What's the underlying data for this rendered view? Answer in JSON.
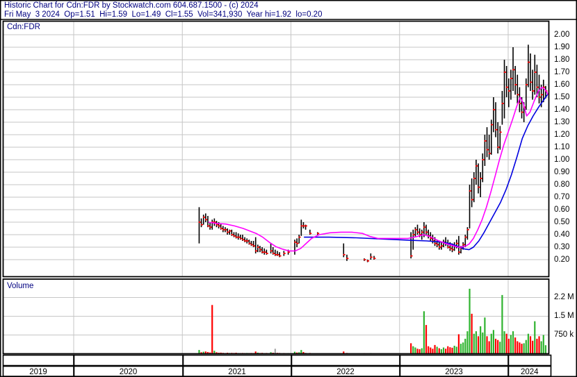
{
  "header": {
    "line1": "Historic Chart for Cdn:FDR by Stockwatch.com 604.687.1500 - (c) 2024",
    "line2": "Fri May  3 2024  Op=1.51  Hi=1.59  Lo=1.49  Cl=1.55  Vol=341,930  Year hi=1.92  lo=0.20"
  },
  "price_panel_label": "Cdn:FDR",
  "volume_panel_label": "Volume",
  "colors": {
    "text_navy": "#000080",
    "text_black": "#000000",
    "grid": "#c6c6c6",
    "bar_black": "#000000",
    "close_red": "#ff0000",
    "ma_fast": "#ff00ff",
    "ma_slow": "#0000e0",
    "vol_up": "#2fb32f",
    "vol_down": "#ff0000",
    "vol_flat": "#a8a8a8",
    "border": "#000000"
  },
  "chart_data": {
    "type": "ohlc-bars+volume",
    "title": "Historic Chart for Cdn:FDR",
    "symbol": "Cdn:FDR",
    "x_unit": "fractional_year",
    "x_range": [
      2019.35,
      2024.38
    ],
    "year_ticks": [
      2020,
      2021,
      2022,
      2023,
      2024
    ],
    "price_axis": [
      {
        "label": "2.00",
        "value": 2.0
      },
      {
        "label": "1.90",
        "value": 1.9
      },
      {
        "label": "1.80",
        "value": 1.8
      },
      {
        "label": "1.70",
        "value": 1.7
      },
      {
        "label": "1.60",
        "value": 1.6
      },
      {
        "label": "1.50",
        "value": 1.5
      },
      {
        "label": "1.40",
        "value": 1.4
      },
      {
        "label": "1.30",
        "value": 1.3
      },
      {
        "label": "1.20",
        "value": 1.2
      },
      {
        "label": "1.10",
        "value": 1.1
      },
      {
        "label": "1.00",
        "value": 1.0
      },
      {
        "label": "0.90",
        "value": 0.9
      },
      {
        "label": "0.80",
        "value": 0.8
      },
      {
        "label": "0.70",
        "value": 0.7
      },
      {
        "label": "0.60",
        "value": 0.6
      },
      {
        "label": "0.50",
        "value": 0.5
      },
      {
        "label": "0.40",
        "value": 0.4
      },
      {
        "label": "0.30",
        "value": 0.3
      },
      {
        "label": "0.20",
        "value": 0.2
      }
    ],
    "volume_axis": [
      {
        "label": "2.2 M",
        "value_k": 2250
      },
      {
        "label": "1.5 M",
        "value_k": 1500
      },
      {
        "label": "750 k",
        "value_k": 750
      }
    ],
    "x_axis_years": [
      "2019",
      "2020",
      "2021",
      "2022",
      "2023",
      "2024"
    ],
    "price_gridlines": [
      0.2,
      0.3,
      0.4,
      0.5,
      0.6,
      0.7,
      0.8,
      0.9,
      1.0,
      1.1,
      1.2,
      1.3,
      1.4,
      1.5,
      1.6,
      1.7,
      1.8,
      1.9,
      2.0
    ],
    "volume_gridlines_k": [
      750,
      1500,
      2250
    ],
    "bars_format": [
      "t_year",
      "high",
      "low",
      "close",
      "volume_thousands",
      "volume_color r=red g=green y=gray"
    ],
    "bars": [
      [
        2021.155,
        0.62,
        0.33,
        0.5,
        150,
        "g"
      ],
      [
        2021.175,
        0.53,
        0.46,
        0.48,
        60,
        "r"
      ],
      [
        2021.195,
        0.56,
        0.48,
        0.54,
        80,
        "g"
      ],
      [
        2021.215,
        0.57,
        0.5,
        0.52,
        90,
        "r"
      ],
      [
        2021.235,
        0.55,
        0.46,
        0.47,
        70,
        "r"
      ],
      [
        2021.255,
        0.5,
        0.44,
        0.46,
        50,
        "r"
      ],
      [
        2021.275,
        0.52,
        0.44,
        0.5,
        1950,
        "r"
      ],
      [
        2021.295,
        0.53,
        0.47,
        0.5,
        120,
        "g"
      ],
      [
        2021.315,
        0.51,
        0.46,
        0.48,
        60,
        "r"
      ],
      [
        2021.335,
        0.5,
        0.45,
        0.47,
        40,
        "r"
      ],
      [
        2021.355,
        0.49,
        0.44,
        0.45,
        45,
        "r"
      ],
      [
        2021.375,
        0.47,
        0.42,
        0.44,
        35,
        "r"
      ],
      [
        2021.395,
        0.46,
        0.42,
        0.44,
        30,
        "y"
      ],
      [
        2021.415,
        0.45,
        0.4,
        0.42,
        40,
        "r"
      ],
      [
        2021.435,
        0.44,
        0.4,
        0.43,
        30,
        "g"
      ],
      [
        2021.455,
        0.44,
        0.39,
        0.4,
        35,
        "r"
      ],
      [
        2021.475,
        0.42,
        0.38,
        0.39,
        30,
        "r"
      ],
      [
        2021.495,
        0.42,
        0.37,
        0.38,
        40,
        "r"
      ],
      [
        2021.515,
        0.41,
        0.36,
        0.38,
        30,
        "y"
      ],
      [
        2021.535,
        0.4,
        0.36,
        0.37,
        25,
        "r"
      ],
      [
        2021.555,
        0.4,
        0.35,
        0.36,
        30,
        "r"
      ],
      [
        2021.575,
        0.38,
        0.34,
        0.35,
        25,
        "r"
      ],
      [
        2021.595,
        0.37,
        0.33,
        0.35,
        30,
        "g"
      ],
      [
        2021.615,
        0.36,
        0.32,
        0.33,
        25,
        "r"
      ],
      [
        2021.635,
        0.35,
        0.31,
        0.32,
        30,
        "r"
      ],
      [
        2021.655,
        0.35,
        0.3,
        0.31,
        25,
        "r"
      ],
      [
        2021.675,
        0.38,
        0.25,
        0.27,
        90,
        "r"
      ],
      [
        2021.695,
        0.32,
        0.26,
        0.3,
        45,
        "g"
      ],
      [
        2021.715,
        0.31,
        0.26,
        0.28,
        30,
        "r"
      ],
      [
        2021.735,
        0.3,
        0.25,
        0.26,
        35,
        "r"
      ],
      [
        2021.755,
        0.29,
        0.24,
        0.26,
        25,
        "y"
      ],
      [
        2021.775,
        0.28,
        0.24,
        0.25,
        30,
        "r"
      ],
      [
        2021.815,
        0.33,
        0.25,
        0.27,
        60,
        "g"
      ],
      [
        2021.835,
        0.3,
        0.24,
        0.25,
        40,
        "r"
      ],
      [
        2021.855,
        0.28,
        0.23,
        0.24,
        200,
        "y"
      ],
      [
        2021.875,
        0.27,
        0.23,
        0.24,
        35,
        "r"
      ],
      [
        2021.895,
        0.26,
        0.22,
        0.23,
        30,
        "r"
      ],
      [
        2021.935,
        0.27,
        0.23,
        0.25,
        25,
        "r"
      ],
      [
        2021.975,
        0.28,
        0.24,
        0.26,
        20,
        "g"
      ],
      [
        2022.035,
        0.36,
        0.24,
        0.34,
        80,
        "g"
      ],
      [
        2022.055,
        0.37,
        0.3,
        0.33,
        50,
        "r"
      ],
      [
        2022.075,
        0.4,
        0.33,
        0.38,
        60,
        "g"
      ],
      [
        2022.095,
        0.52,
        0.39,
        0.47,
        150,
        "g"
      ],
      [
        2022.115,
        0.5,
        0.45,
        0.47,
        70,
        "r"
      ],
      [
        2022.135,
        0.48,
        0.44,
        0.47,
        40,
        "y"
      ],
      [
        2022.175,
        0.44,
        0.4,
        0.41,
        30,
        "r"
      ],
      [
        2022.245,
        0.42,
        0.4,
        0.41,
        15,
        "r"
      ],
      [
        2022.485,
        0.33,
        0.22,
        0.24,
        90,
        "r"
      ],
      [
        2022.515,
        0.24,
        0.19,
        0.21,
        30,
        "r"
      ],
      [
        2022.675,
        0.21,
        0.19,
        0.2,
        20,
        "r"
      ],
      [
        2022.705,
        0.2,
        0.18,
        0.19,
        15,
        "r"
      ],
      [
        2022.735,
        0.25,
        0.2,
        0.22,
        25,
        "g"
      ],
      [
        2022.765,
        0.23,
        0.2,
        0.21,
        15,
        "r"
      ],
      [
        2023.105,
        0.42,
        0.21,
        0.23,
        420,
        "r"
      ],
      [
        2023.125,
        0.44,
        0.28,
        0.4,
        300,
        "g"
      ],
      [
        2023.145,
        0.46,
        0.38,
        0.44,
        250,
        "g"
      ],
      [
        2023.165,
        0.48,
        0.4,
        0.42,
        200,
        "r"
      ],
      [
        2023.185,
        0.45,
        0.38,
        0.4,
        180,
        "r"
      ],
      [
        2023.205,
        0.44,
        0.36,
        0.42,
        220,
        "g"
      ],
      [
        2023.225,
        0.5,
        0.38,
        0.46,
        1700,
        "g"
      ],
      [
        2023.245,
        0.48,
        0.4,
        0.42,
        1150,
        "r"
      ],
      [
        2023.265,
        0.44,
        0.37,
        0.39,
        300,
        "r"
      ],
      [
        2023.285,
        0.42,
        0.35,
        0.37,
        250,
        "r"
      ],
      [
        2023.305,
        0.4,
        0.33,
        0.35,
        200,
        "r"
      ],
      [
        2023.325,
        0.38,
        0.31,
        0.33,
        350,
        "r"
      ],
      [
        2023.345,
        0.36,
        0.3,
        0.32,
        280,
        "g"
      ],
      [
        2023.365,
        0.35,
        0.28,
        0.3,
        220,
        "r"
      ],
      [
        2023.385,
        0.34,
        0.28,
        0.31,
        180,
        "g"
      ],
      [
        2023.405,
        0.36,
        0.3,
        0.34,
        250,
        "g"
      ],
      [
        2023.425,
        0.38,
        0.31,
        0.33,
        200,
        "r"
      ],
      [
        2023.445,
        0.36,
        0.29,
        0.3,
        300,
        "r"
      ],
      [
        2023.465,
        0.34,
        0.27,
        0.29,
        260,
        "r"
      ],
      [
        2023.485,
        0.33,
        0.26,
        0.28,
        240,
        "r"
      ],
      [
        2023.505,
        0.34,
        0.27,
        0.31,
        320,
        "g"
      ],
      [
        2023.525,
        0.36,
        0.29,
        0.33,
        280,
        "g"
      ],
      [
        2023.545,
        0.39,
        0.24,
        0.26,
        780,
        "r"
      ],
      [
        2023.565,
        0.31,
        0.25,
        0.29,
        400,
        "g"
      ],
      [
        2023.585,
        0.34,
        0.28,
        0.32,
        450,
        "g"
      ],
      [
        2023.605,
        0.4,
        0.3,
        0.38,
        600,
        "g"
      ],
      [
        2023.625,
        0.46,
        0.36,
        0.44,
        900,
        "g"
      ],
      [
        2023.645,
        0.8,
        0.45,
        0.75,
        2600,
        "g"
      ],
      [
        2023.665,
        0.85,
        0.62,
        0.68,
        1600,
        "r"
      ],
      [
        2023.685,
        0.9,
        0.66,
        0.85,
        800,
        "g"
      ],
      [
        2023.705,
        1.0,
        0.8,
        0.95,
        900,
        "g"
      ],
      [
        2023.725,
        0.97,
        0.73,
        0.78,
        700,
        "r"
      ],
      [
        2023.745,
        0.9,
        0.7,
        0.85,
        1100,
        "g"
      ],
      [
        2023.765,
        1.05,
        0.82,
        1.0,
        850,
        "g"
      ],
      [
        2023.785,
        1.2,
        0.95,
        1.15,
        1450,
        "g"
      ],
      [
        2023.805,
        1.26,
        1.02,
        1.08,
        700,
        "r"
      ],
      [
        2023.825,
        1.2,
        1.0,
        1.05,
        500,
        "r"
      ],
      [
        2023.845,
        1.32,
        1.04,
        1.28,
        800,
        "g"
      ],
      [
        2023.865,
        1.5,
        1.22,
        1.4,
        950,
        "g"
      ],
      [
        2023.885,
        1.46,
        1.18,
        1.24,
        600,
        "r"
      ],
      [
        2023.905,
        1.3,
        1.05,
        1.1,
        550,
        "r"
      ],
      [
        2023.925,
        1.27,
        1.08,
        1.22,
        480,
        "g"
      ],
      [
        2023.945,
        1.55,
        1.28,
        1.45,
        2350,
        "g"
      ],
      [
        2023.965,
        1.8,
        1.33,
        1.7,
        900,
        "g"
      ],
      [
        2023.985,
        1.75,
        1.5,
        1.58,
        800,
        "r"
      ],
      [
        2024.005,
        1.65,
        1.42,
        1.55,
        600,
        "r"
      ],
      [
        2024.025,
        1.72,
        1.48,
        1.65,
        750,
        "g"
      ],
      [
        2024.045,
        1.9,
        1.55,
        1.72,
        900,
        "g"
      ],
      [
        2024.065,
        1.75,
        1.52,
        1.6,
        650,
        "r"
      ],
      [
        2024.085,
        1.68,
        1.45,
        1.52,
        500,
        "r"
      ],
      [
        2024.105,
        1.58,
        1.38,
        1.45,
        450,
        "r"
      ],
      [
        2024.125,
        1.5,
        1.33,
        1.38,
        400,
        "r"
      ],
      [
        2024.145,
        1.46,
        1.3,
        1.42,
        420,
        "g"
      ],
      [
        2024.165,
        1.65,
        1.4,
        1.6,
        550,
        "g"
      ],
      [
        2024.185,
        1.92,
        1.58,
        1.78,
        800,
        "g"
      ],
      [
        2024.205,
        1.85,
        1.55,
        1.62,
        700,
        "r"
      ],
      [
        2024.225,
        1.72,
        1.48,
        1.55,
        520,
        "r"
      ],
      [
        2024.245,
        1.84,
        1.52,
        1.7,
        1300,
        "g"
      ],
      [
        2024.265,
        1.76,
        1.5,
        1.58,
        600,
        "r"
      ],
      [
        2024.285,
        1.68,
        1.45,
        1.5,
        700,
        "r"
      ],
      [
        2024.305,
        1.6,
        1.42,
        1.52,
        500,
        "g"
      ],
      [
        2024.325,
        1.64,
        1.46,
        1.58,
        750,
        "g"
      ],
      [
        2024.345,
        1.59,
        1.49,
        1.55,
        342,
        "g"
      ]
    ],
    "ma_fast_magenta": [
      [
        2021.24,
        0.5
      ],
      [
        2021.32,
        0.49
      ],
      [
        2021.4,
        0.485
      ],
      [
        2021.48,
        0.47
      ],
      [
        2021.56,
        0.45
      ],
      [
        2021.62,
        0.43
      ],
      [
        2021.68,
        0.41
      ],
      [
        2021.74,
        0.38
      ],
      [
        2021.8,
        0.34
      ],
      [
        2021.86,
        0.305
      ],
      [
        2021.92,
        0.285
      ],
      [
        2021.98,
        0.27
      ],
      [
        2022.04,
        0.27
      ],
      [
        2022.09,
        0.29
      ],
      [
        2022.14,
        0.33
      ],
      [
        2022.19,
        0.37
      ],
      [
        2022.26,
        0.4
      ],
      [
        2022.36,
        0.415
      ],
      [
        2022.46,
        0.42
      ],
      [
        2022.56,
        0.42
      ],
      [
        2022.66,
        0.41
      ],
      [
        2022.73,
        0.385
      ],
      [
        2022.8,
        0.37
      ],
      [
        2022.95,
        0.37
      ],
      [
        2023.08,
        0.37
      ],
      [
        2023.16,
        0.385
      ],
      [
        2023.22,
        0.4
      ],
      [
        2023.28,
        0.385
      ],
      [
        2023.35,
        0.355
      ],
      [
        2023.42,
        0.33
      ],
      [
        2023.48,
        0.315
      ],
      [
        2023.54,
        0.3
      ],
      [
        2023.6,
        0.305
      ],
      [
        2023.64,
        0.325
      ],
      [
        2023.68,
        0.37
      ],
      [
        2023.72,
        0.44
      ],
      [
        2023.76,
        0.52
      ],
      [
        2023.8,
        0.62
      ],
      [
        2023.84,
        0.74
      ],
      [
        2023.88,
        0.87
      ],
      [
        2023.92,
        1.0
      ],
      [
        2023.96,
        1.12
      ],
      [
        2024.0,
        1.22
      ],
      [
        2024.04,
        1.32
      ],
      [
        2024.08,
        1.43
      ],
      [
        2024.11,
        1.5
      ],
      [
        2024.14,
        1.45
      ],
      [
        2024.17,
        1.35
      ],
      [
        2024.2,
        1.38
      ],
      [
        2024.24,
        1.47
      ],
      [
        2024.28,
        1.55
      ],
      [
        2024.31,
        1.58
      ],
      [
        2024.34,
        1.56
      ],
      [
        2024.37,
        1.52
      ]
    ],
    "ma_slow_blue": [
      [
        2022.12,
        0.38
      ],
      [
        2022.35,
        0.38
      ],
      [
        2022.6,
        0.375
      ],
      [
        2022.85,
        0.365
      ],
      [
        2023.1,
        0.355
      ],
      [
        2023.25,
        0.35
      ],
      [
        2023.4,
        0.34
      ],
      [
        2023.48,
        0.325
      ],
      [
        2023.54,
        0.305
      ],
      [
        2023.6,
        0.285
      ],
      [
        2023.64,
        0.28
      ],
      [
        2023.68,
        0.3
      ],
      [
        2023.73,
        0.35
      ],
      [
        2023.78,
        0.42
      ],
      [
        2023.83,
        0.5
      ],
      [
        2023.88,
        0.58
      ],
      [
        2023.93,
        0.66
      ],
      [
        2023.98,
        0.76
      ],
      [
        2024.03,
        0.88
      ],
      [
        2024.08,
        1.02
      ],
      [
        2024.13,
        1.17
      ],
      [
        2024.18,
        1.27
      ],
      [
        2024.23,
        1.35
      ],
      [
        2024.28,
        1.42
      ],
      [
        2024.32,
        1.47
      ],
      [
        2024.37,
        1.53
      ]
    ]
  }
}
